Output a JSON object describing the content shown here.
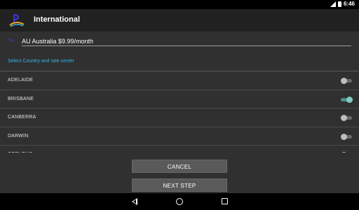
{
  "status_bar": {
    "time": "6:46",
    "icons": [
      "signal-icon",
      "battery-icon"
    ]
  },
  "app_bar": {
    "title": "International",
    "logo": "app-logo-icon"
  },
  "plan": {
    "label": "Plan",
    "value": "AU Australia $9.99/month"
  },
  "select_label": "Select Country and rate center",
  "rate_centers": [
    {
      "label": "ADELAIDE",
      "enabled": false
    },
    {
      "label": "BRISBANE",
      "enabled": true
    },
    {
      "label": "CANBERRA",
      "enabled": false
    },
    {
      "label": "DARWIN",
      "enabled": false
    },
    {
      "label": "GEELONG",
      "enabled": false
    }
  ],
  "buttons": {
    "cancel": "CANCEL",
    "next_step": "NEXT STEP"
  },
  "nav_bar": {
    "icons": [
      "back-icon",
      "home-icon",
      "recents-icon"
    ]
  },
  "colors": {
    "accent": "#33b5e5",
    "toggle_on": "#80cbc4",
    "background": "#303030",
    "app_bar": "#212121"
  }
}
